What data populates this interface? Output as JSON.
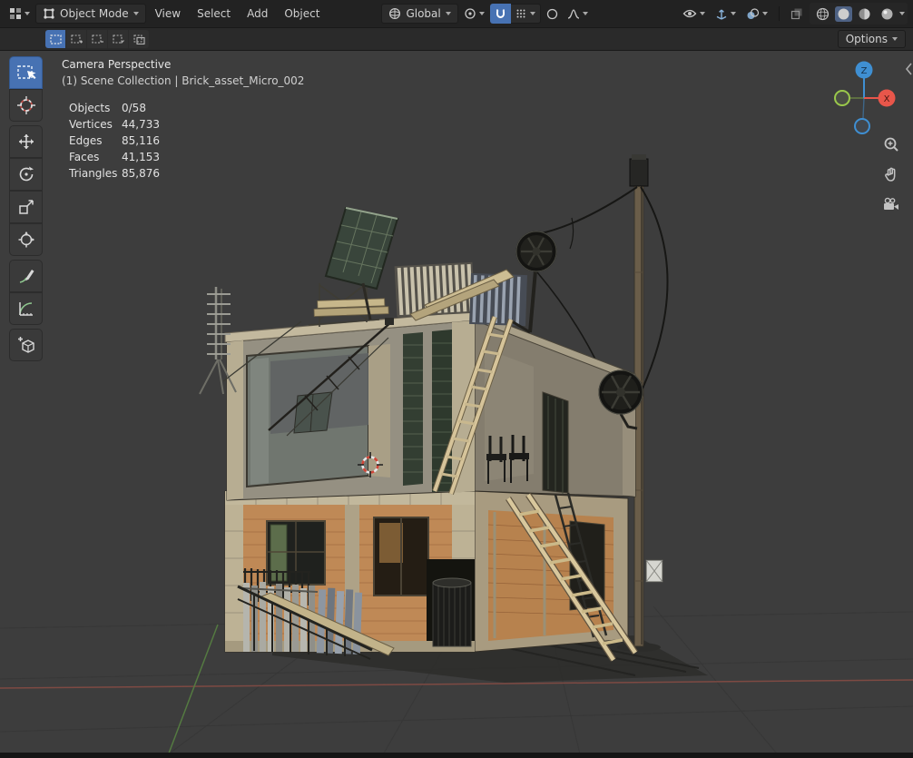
{
  "colors": {
    "accent_blue": "#4772b3",
    "axis_x_red": "#e8564a",
    "axis_y_green": "#9ac84b",
    "axis_z_blue": "#3f8fd2",
    "viewport_bg": "#3d3d3d",
    "header_bg": "#222222"
  },
  "topbar": {
    "mode": {
      "label": "Object Mode"
    },
    "menus": [
      {
        "label": "View"
      },
      {
        "label": "Select"
      },
      {
        "label": "Add"
      },
      {
        "label": "Object"
      }
    ],
    "transform_orientation": {
      "label": "Global"
    }
  },
  "tool_settings": {
    "options_label": "Options"
  },
  "viewport": {
    "view_label": "Camera Perspective",
    "context_label": "(1) Scene Collection | Brick_asset_Micro_002",
    "stats": {
      "rows": [
        {
          "label": "Objects",
          "value": "0/58"
        },
        {
          "label": "Vertices",
          "value": "44,733"
        },
        {
          "label": "Edges",
          "value": "85,116"
        },
        {
          "label": "Faces",
          "value": "41,153"
        },
        {
          "label": "Triangles",
          "value": "85,876"
        }
      ]
    },
    "gizmo": {
      "z": "Z",
      "x": "X"
    }
  }
}
